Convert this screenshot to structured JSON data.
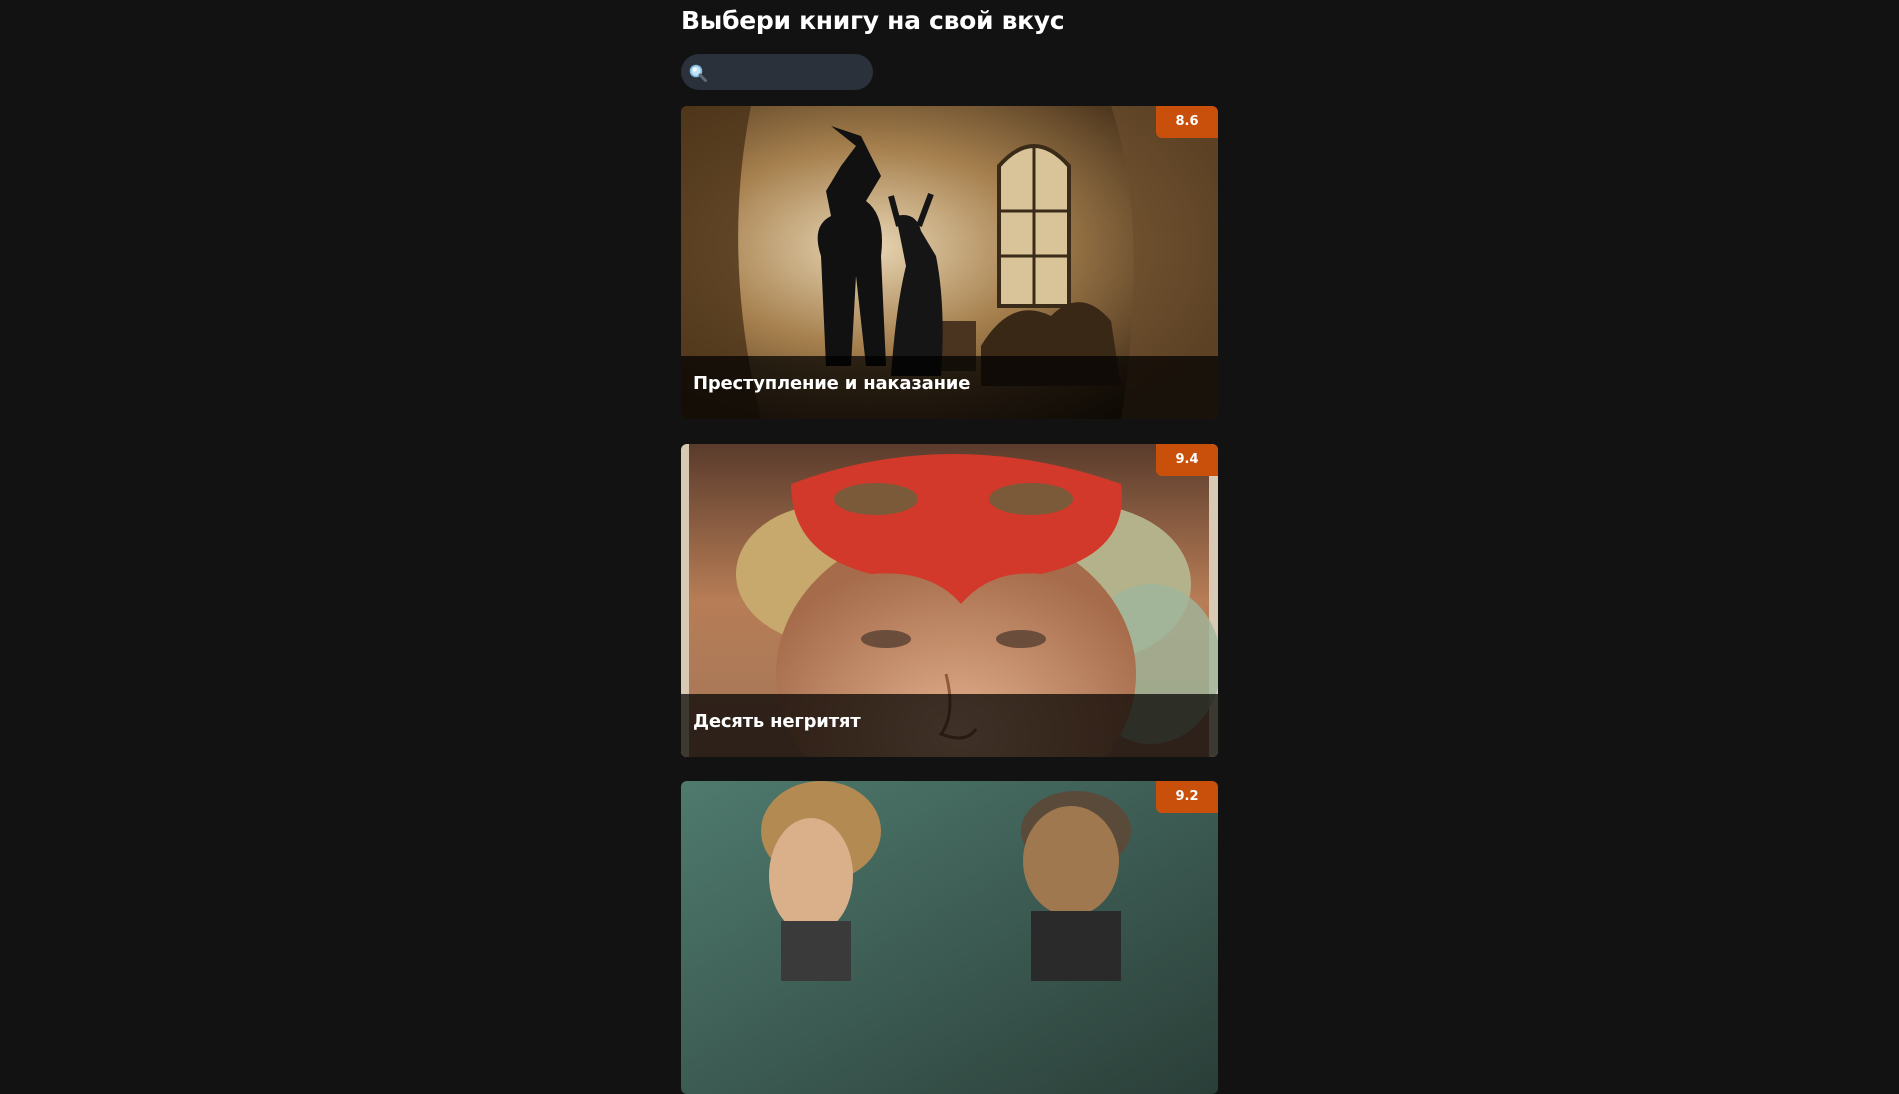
{
  "header": {
    "title": "Выбери книгу на свой вкус"
  },
  "search": {
    "icon": "search-icon",
    "value": "",
    "placeholder": ""
  },
  "books": [
    {
      "title": "Преступление и наказание",
      "rating": "8.6",
      "art": "silhouettes-bedroom-illustration"
    },
    {
      "title": "Десять негритят",
      "rating": "9.4",
      "art": "woman-red-mask-illustration"
    },
    {
      "title": "",
      "rating": "9.2",
      "art": "two-men-portrait-illustration"
    }
  ],
  "colors": {
    "background": "#121212",
    "badge": "#c9500b",
    "search_bg": "#2b313b"
  }
}
